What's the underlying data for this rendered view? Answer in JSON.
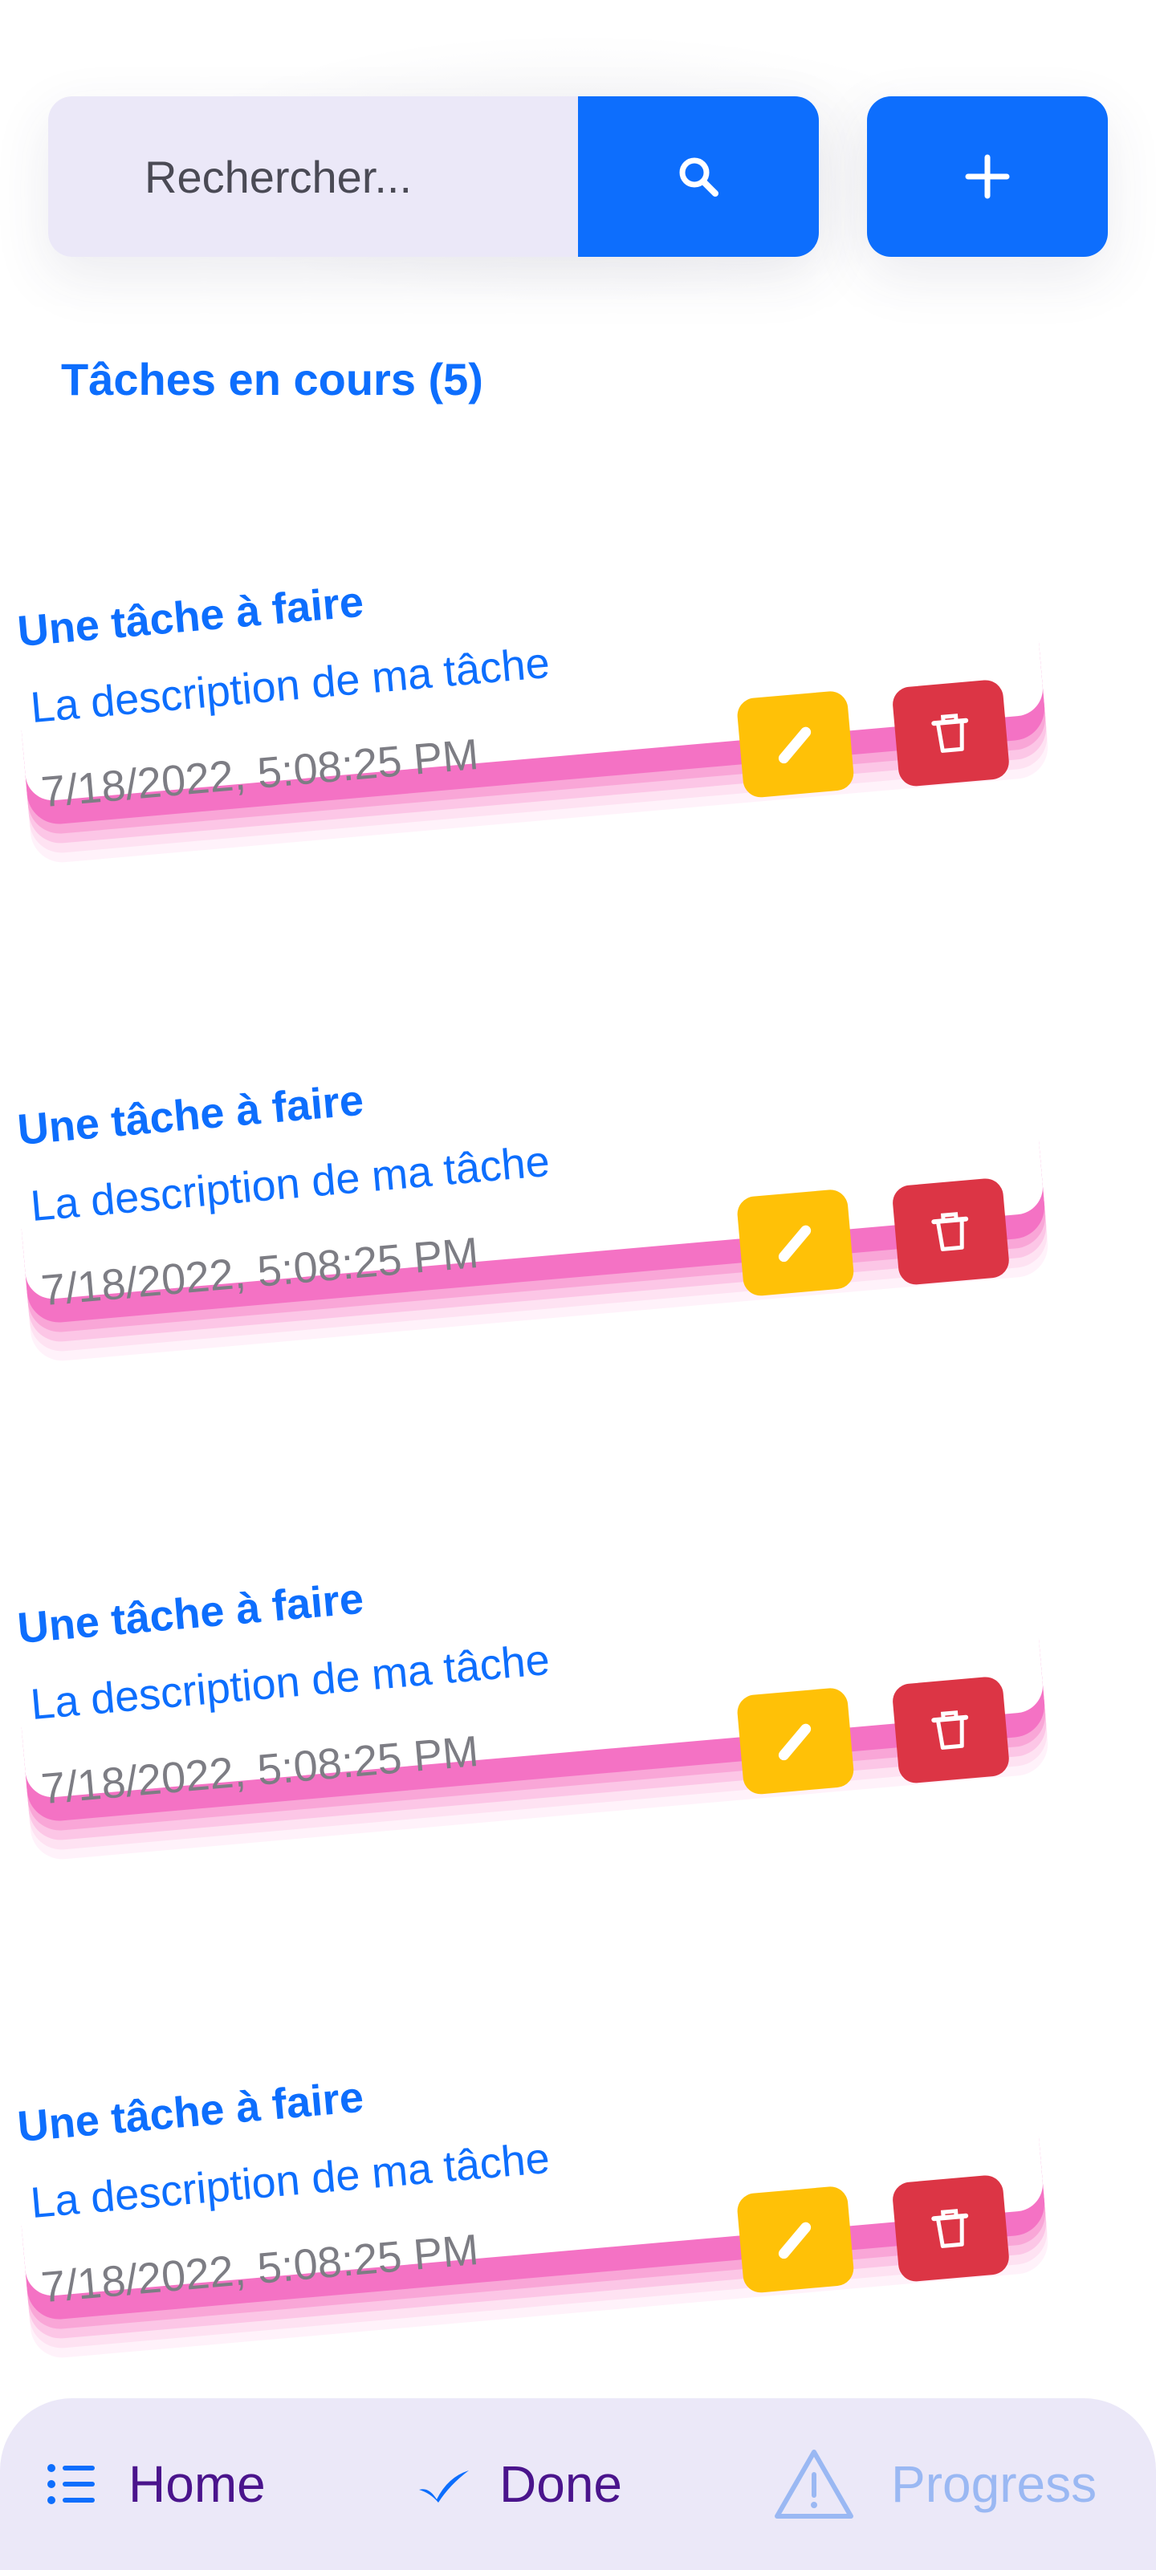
{
  "search": {
    "placeholder": "Rechercher...",
    "button_icon": "search-icon",
    "add_icon": "plus-icon"
  },
  "section": {
    "title": "Tâches en cours (5)"
  },
  "tasks": [
    {
      "title": "Une tâche à faire",
      "description": "La description de ma tâche",
      "date": "7/18/2022, 5:08:25 PM"
    },
    {
      "title": "Une tâche à faire",
      "description": "La description de ma tâche",
      "date": "7/18/2022, 5:08:25 PM"
    },
    {
      "title": "Une tâche à faire",
      "description": "La description de ma tâche",
      "date": "7/18/2022, 5:08:25 PM"
    },
    {
      "title": "Une tâche à faire",
      "description": "La description de ma tâche",
      "date": "7/18/2022, 5:08:25 PM"
    }
  ],
  "nav": {
    "home": "Home",
    "done": "Done",
    "progress": "Progress"
  },
  "colors": {
    "primary": "#0d6efd",
    "edit": "#ffc107",
    "delete": "#dc3545",
    "card_stack": "#f472c4",
    "nav_bg": "#ebe8f8",
    "nav_active": "#4a148c",
    "nav_inactive": "#9ab8f3"
  }
}
